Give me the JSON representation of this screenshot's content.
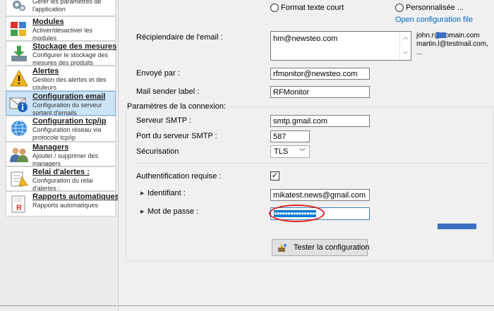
{
  "sidebar": {
    "items": [
      {
        "title": "",
        "desc": "Gérer les paramètres de l'application",
        "icon": "gears-icon"
      },
      {
        "title": "Modules",
        "desc": "Activer/désactiver les modules",
        "icon": "modules-icon"
      },
      {
        "title": "Stockage des mesures",
        "desc": "Configurer le stockage des mesures des produits",
        "icon": "download-storage-icon"
      },
      {
        "title": "Alertes",
        "desc": "Gestion des alertes et des couleurs",
        "icon": "warning-icon"
      },
      {
        "title": "Configuration email",
        "desc": "Configuration du serveur sortant d'emails",
        "icon": "email-info-icon"
      },
      {
        "title": "Configuration tcp/ip",
        "desc": "Configuration réseau via protocole tcp/ip",
        "icon": "network-icon"
      },
      {
        "title": "Managers",
        "desc": "Ajouter / supprimer des managers",
        "icon": "users-icon"
      },
      {
        "title": "Relai d'alertes :",
        "desc": "Configuration du relai d'alertes :",
        "icon": "relay-icon"
      },
      {
        "title": "Rapports automatiques",
        "desc": "Rapports automatiques",
        "icon": "report-icon"
      }
    ]
  },
  "format": {
    "short_label": "Format texte court",
    "custom_label": "Personnalisée ...",
    "open_config_link": "Open configuration file"
  },
  "recipient": {
    "label": "Récipiendaire de l'email :",
    "value": "hm@newsteo.com",
    "examples": [
      "john.r@domain.com",
      "martin.l@testmail.com,",
      "..."
    ]
  },
  "sender": {
    "label": "Envoyé par :",
    "value": "rfmonitor@newsteo.com"
  },
  "sender_label": {
    "label": "Mail sender label :",
    "value": "RFMonitor"
  },
  "connection": {
    "group_title": "Paramètres de la connexion:",
    "smtp_label": "Serveur SMTP :",
    "smtp_value": "smtp.gmail.com",
    "port_label": "Port du serveur SMTP :",
    "port_value": "587",
    "security_label": "Sécurisation",
    "security_value": "TLS",
    "auth_label": "Authentification requise :",
    "auth_checked": true,
    "auth_mark": "✓",
    "identifier_label": "Identifiant :",
    "identifier_value": "mikatest.news@gmail.com",
    "password_label": "Mot de passe :",
    "password_mask": "●●●●●●●●●●●●●●●●"
  },
  "actions": {
    "test_button": "Tester la configuration"
  }
}
